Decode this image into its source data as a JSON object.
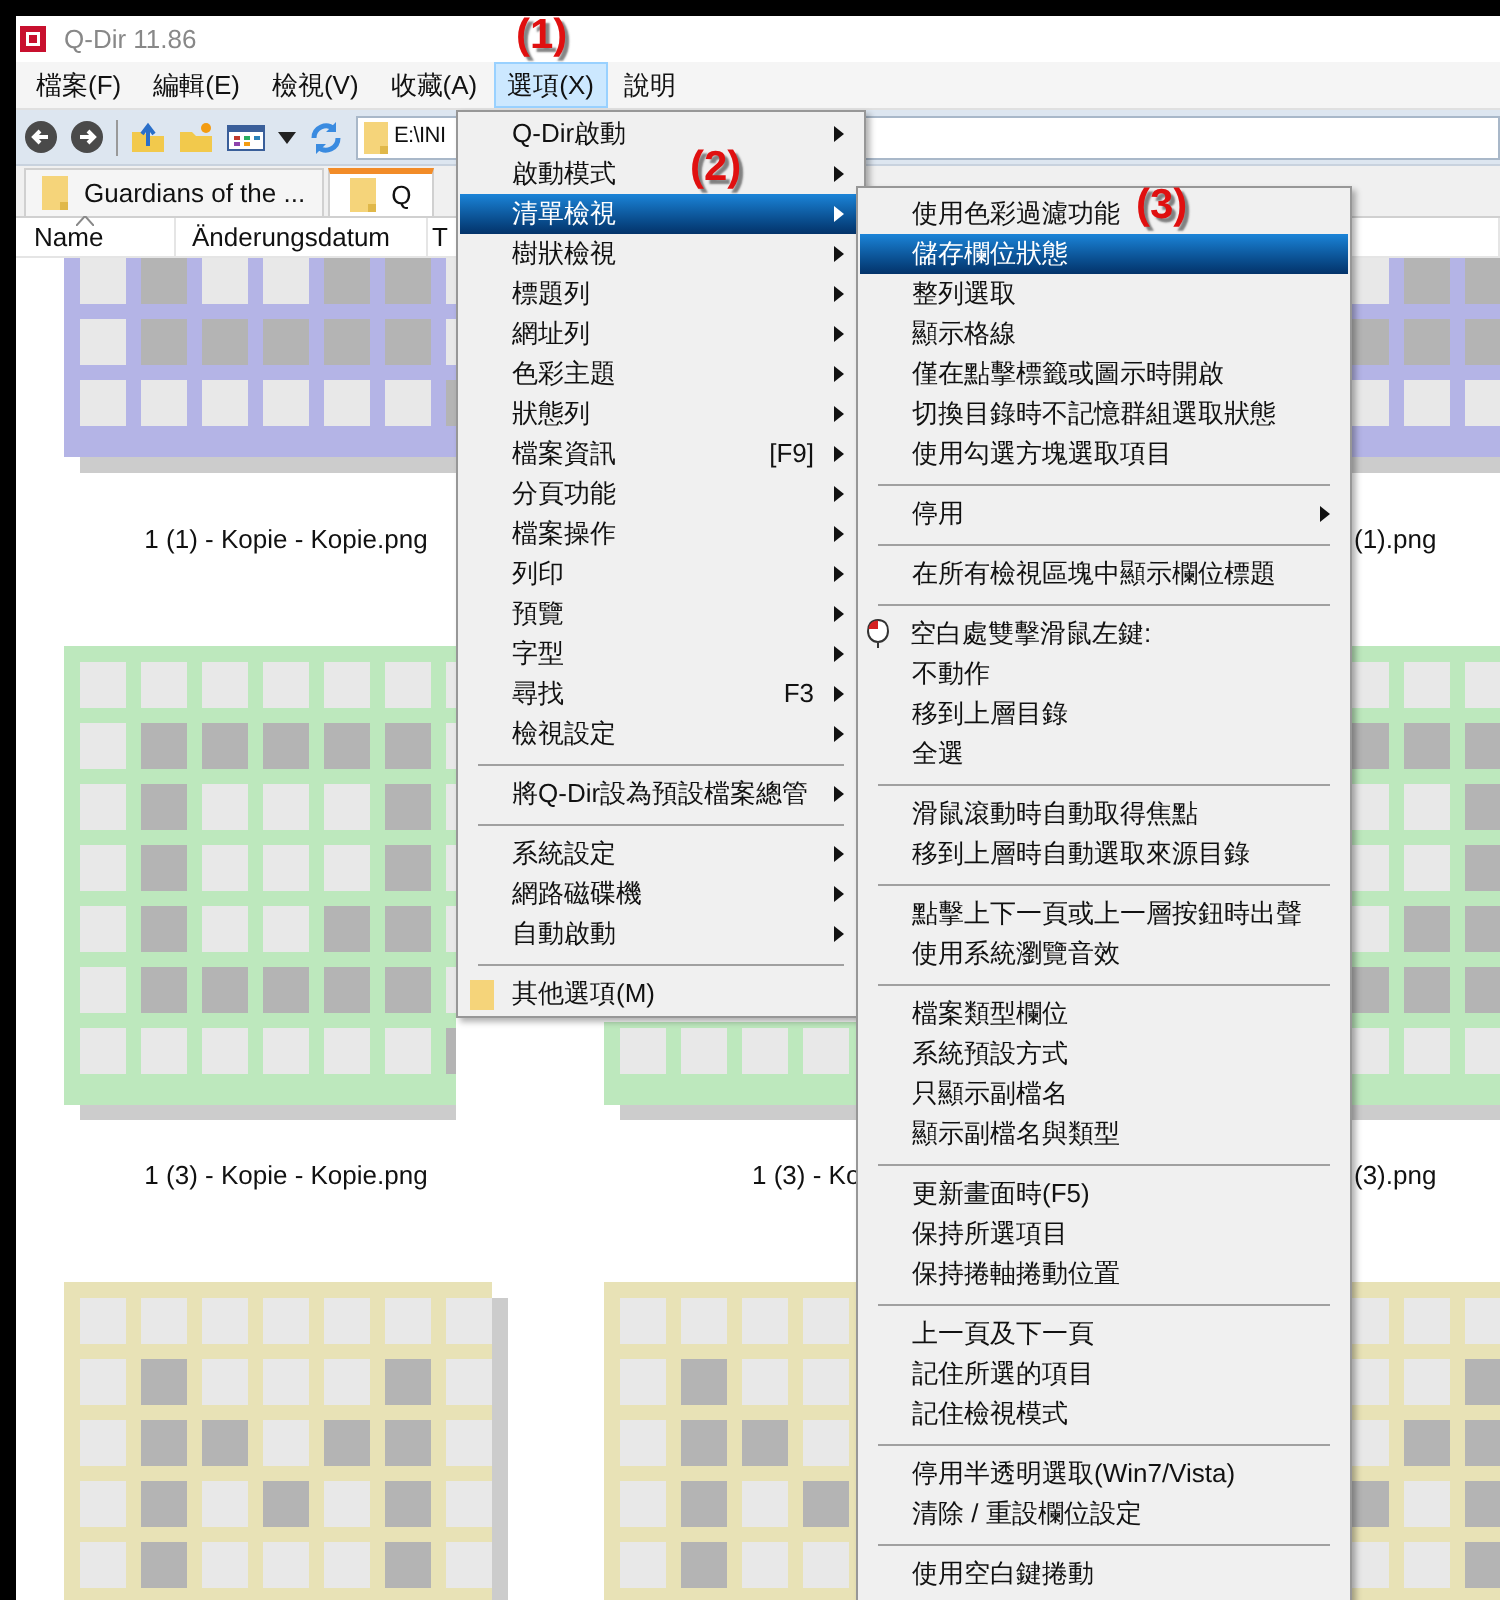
{
  "window": {
    "title": "Q-Dir 11.86"
  },
  "menu_bar": [
    {
      "label": "檔案(F)",
      "selected": false
    },
    {
      "label": "編輯(E)",
      "selected": false
    },
    {
      "label": "檢視(V)",
      "selected": false
    },
    {
      "label": "收藏(A)",
      "selected": false
    },
    {
      "label": "選項(X)",
      "selected": true
    },
    {
      "label": "說明",
      "selected": false
    }
  ],
  "address": {
    "value": "E:\\INI"
  },
  "tabs": [
    {
      "label": "Guardians of the ...",
      "selected": false
    },
    {
      "label": "Q",
      "selected": true
    }
  ],
  "columns": [
    {
      "label": "Name",
      "sorted": true
    },
    {
      "label": "Änderungsdatum",
      "sorted": false
    },
    {
      "label": "T",
      "sorted": false
    }
  ],
  "thumbnail_rows": [
    {
      "thumbnails": [
        {
          "color": "#b4b4e6",
          "caption": "1 (1) - Kopie - Kopie.png"
        },
        {
          "color": "#b4b4e6",
          "caption": "(1).png"
        }
      ]
    },
    {
      "thumbnails": [
        {
          "color": "#bde8bd",
          "caption": "1 (3) - Kopie - Kopie.png"
        },
        {
          "color": "#bde8bd",
          "caption": "1 (3) - Ko"
        },
        {
          "color": "#bde8bd",
          "caption": "(3).png"
        }
      ]
    },
    {
      "thumbnails": [
        {
          "color": "#e8e2b6"
        },
        {
          "color": "#e8e2b6"
        },
        {
          "color": "#e8e2b6"
        }
      ]
    }
  ],
  "options_menu": {
    "items": [
      {
        "kind": "item",
        "label": "Q-Dir啟動",
        "has_submenu": true,
        "selected": false
      },
      {
        "kind": "item",
        "label": "啟動模式",
        "has_submenu": true,
        "selected": false
      },
      {
        "kind": "item",
        "label": "清單檢視",
        "has_submenu": true,
        "selected": true
      },
      {
        "kind": "item",
        "label": "樹狀檢視",
        "has_submenu": true,
        "selected": false
      },
      {
        "kind": "item",
        "label": "標題列",
        "has_submenu": true,
        "selected": false
      },
      {
        "kind": "item",
        "label": "網址列",
        "has_submenu": true,
        "selected": false
      },
      {
        "kind": "item",
        "label": "色彩主題",
        "has_submenu": true,
        "selected": false
      },
      {
        "kind": "item",
        "label": "狀態列",
        "has_submenu": true,
        "selected": false
      },
      {
        "kind": "item",
        "label": "檔案資訊",
        "shortcut": "[F9]",
        "has_submenu": true,
        "selected": false
      },
      {
        "kind": "item",
        "label": "分頁功能",
        "has_submenu": true,
        "selected": false
      },
      {
        "kind": "item",
        "label": "檔案操作",
        "has_submenu": true,
        "selected": false
      },
      {
        "kind": "item",
        "label": "列印",
        "has_submenu": true,
        "selected": false
      },
      {
        "kind": "item",
        "label": "預覽",
        "has_submenu": true,
        "selected": false
      },
      {
        "kind": "item",
        "label": "字型",
        "has_submenu": true,
        "selected": false
      },
      {
        "kind": "item",
        "label": "尋找",
        "shortcut": "F3",
        "has_submenu": true,
        "selected": false
      },
      {
        "kind": "item",
        "label": "檢視設定",
        "has_submenu": true,
        "selected": false
      },
      {
        "kind": "separator"
      },
      {
        "kind": "item",
        "label": "將Q-Dir設為預設檔案總管",
        "has_submenu": true,
        "selected": false
      },
      {
        "kind": "separator"
      },
      {
        "kind": "item",
        "label": "系統設定",
        "has_submenu": true,
        "selected": false
      },
      {
        "kind": "item",
        "label": "網路磁碟機",
        "has_submenu": true,
        "selected": false
      },
      {
        "kind": "item",
        "label": "自動啟動",
        "has_submenu": true,
        "selected": false
      },
      {
        "kind": "separator"
      },
      {
        "kind": "folder_item",
        "label": "其他選項(M)",
        "has_submenu": false,
        "selected": false
      }
    ]
  },
  "list_view_submenu": {
    "items": [
      {
        "kind": "item",
        "label": "使用色彩過濾功能",
        "has_submenu": false,
        "selected": false
      },
      {
        "kind": "item",
        "label": "儲存欄位狀態",
        "has_submenu": false,
        "selected": true
      },
      {
        "kind": "item",
        "label": "整列選取",
        "has_submenu": false,
        "selected": false
      },
      {
        "kind": "item",
        "label": "顯示格線",
        "has_submenu": false,
        "selected": false
      },
      {
        "kind": "item",
        "label": "僅在點擊標籤或圖示時開啟",
        "has_submenu": false,
        "selected": false
      },
      {
        "kind": "item",
        "label": "切換目錄時不記憶群組選取狀態",
        "has_submenu": false,
        "selected": false
      },
      {
        "kind": "item",
        "label": "使用勾選方塊選取項目",
        "has_submenu": false,
        "selected": false
      },
      {
        "kind": "separator"
      },
      {
        "kind": "item",
        "label": "停用",
        "has_submenu": true,
        "selected": false
      },
      {
        "kind": "separator"
      },
      {
        "kind": "item",
        "label": "在所有檢視區塊中顯示欄位標題",
        "has_submenu": false,
        "selected": false
      },
      {
        "kind": "separator"
      },
      {
        "kind": "mouse_label",
        "label": "空白處雙擊滑鼠左鍵:"
      },
      {
        "kind": "item",
        "label": "不動作",
        "has_submenu": false,
        "selected": false
      },
      {
        "kind": "item",
        "label": "移到上層目錄",
        "has_submenu": false,
        "selected": false
      },
      {
        "kind": "item",
        "label": "全選",
        "has_submenu": false,
        "selected": false
      },
      {
        "kind": "separator"
      },
      {
        "kind": "item",
        "label": "滑鼠滾動時自動取得焦點",
        "has_submenu": false,
        "selected": false
      },
      {
        "kind": "item",
        "label": "移到上層時自動選取來源目錄",
        "has_submenu": false,
        "selected": false
      },
      {
        "kind": "separator"
      },
      {
        "kind": "item",
        "label": "點擊上下一頁或上一層按鈕時出聲",
        "has_submenu": false,
        "selected": false
      },
      {
        "kind": "item",
        "label": "使用系統瀏覽音效",
        "has_submenu": false,
        "selected": false
      },
      {
        "kind": "separator"
      },
      {
        "kind": "item",
        "label": "檔案類型欄位",
        "has_submenu": false,
        "selected": false
      },
      {
        "kind": "item",
        "label": "系統預設方式",
        "has_submenu": false,
        "selected": false
      },
      {
        "kind": "item",
        "label": "只顯示副檔名",
        "has_submenu": false,
        "selected": false
      },
      {
        "kind": "item",
        "label": "顯示副檔名與類型",
        "has_submenu": false,
        "selected": false
      },
      {
        "kind": "separator"
      },
      {
        "kind": "item",
        "label": "更新畫面時(F5)",
        "has_submenu": false,
        "selected": false
      },
      {
        "kind": "item",
        "label": "保持所選項目",
        "has_submenu": false,
        "selected": false
      },
      {
        "kind": "item",
        "label": "保持捲軸捲動位置",
        "has_submenu": false,
        "selected": false
      },
      {
        "kind": "separator"
      },
      {
        "kind": "item",
        "label": "上一頁及下一頁",
        "has_submenu": false,
        "selected": false
      },
      {
        "kind": "item",
        "label": "記住所選的項目",
        "has_submenu": false,
        "selected": false
      },
      {
        "kind": "item",
        "label": "記住檢視模式",
        "has_submenu": false,
        "selected": false
      },
      {
        "kind": "separator"
      },
      {
        "kind": "item",
        "label": "停用半透明選取(Win7/Vista)",
        "has_submenu": false,
        "selected": false
      },
      {
        "kind": "item",
        "label": "清除 / 重設欄位設定",
        "has_submenu": false,
        "selected": false
      },
      {
        "kind": "separator"
      },
      {
        "kind": "item",
        "label": "使用空白鍵捲動",
        "has_submenu": false,
        "selected": false
      }
    ]
  },
  "annotations": [
    {
      "text": "(1)"
    },
    {
      "text": "(2)"
    },
    {
      "text": "(3)"
    }
  ]
}
